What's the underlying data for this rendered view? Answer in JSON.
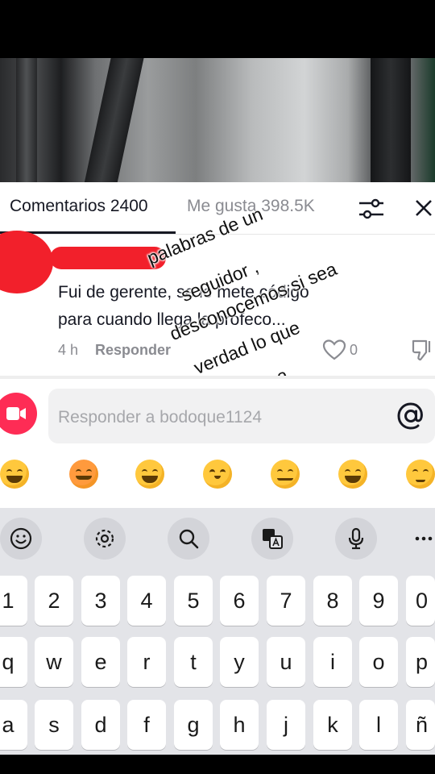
{
  "video": {
    "overlay_lines": [
      "palabras de un",
      "seguidor ,",
      "desconocemos si sea",
      "verdad lo que",
      "menciona"
    ]
  },
  "comments_header": {
    "comments_tab": "Comentarios 2400",
    "likes_tab": "Me gusta 398.5K"
  },
  "comment": {
    "text_line1": "Fui de gerente, se le mete código",
    "text_line2": "para cuando llega la profeco...",
    "time": "4 h",
    "reply_label": "Responder",
    "like_count": "0"
  },
  "reply_box": {
    "placeholder": "Responder a bodoque1124"
  },
  "emoji_bar": [
    "grinning-squinting",
    "smiling-with-hearts",
    "tears-of-joy",
    "flushed",
    "smirking",
    "grinning-sweat",
    "pleading"
  ],
  "keyboard": {
    "number_row": [
      "1",
      "2",
      "3",
      "4",
      "5",
      "6",
      "7",
      "8",
      "9",
      "0"
    ],
    "row_q": [
      "q",
      "w",
      "e",
      "r",
      "t",
      "y",
      "u",
      "i",
      "o",
      "p"
    ],
    "row_a": [
      "a",
      "s",
      "d",
      "f",
      "g",
      "h",
      "j",
      "k",
      "l",
      "ñ"
    ],
    "toolbar_icons": [
      "emoji-icon",
      "settings-icon",
      "search-icon",
      "translate-icon",
      "mic-icon",
      "more-icon"
    ]
  },
  "colors": {
    "accent_red": "#fe2c55",
    "redaction_red": "#f2202b"
  }
}
